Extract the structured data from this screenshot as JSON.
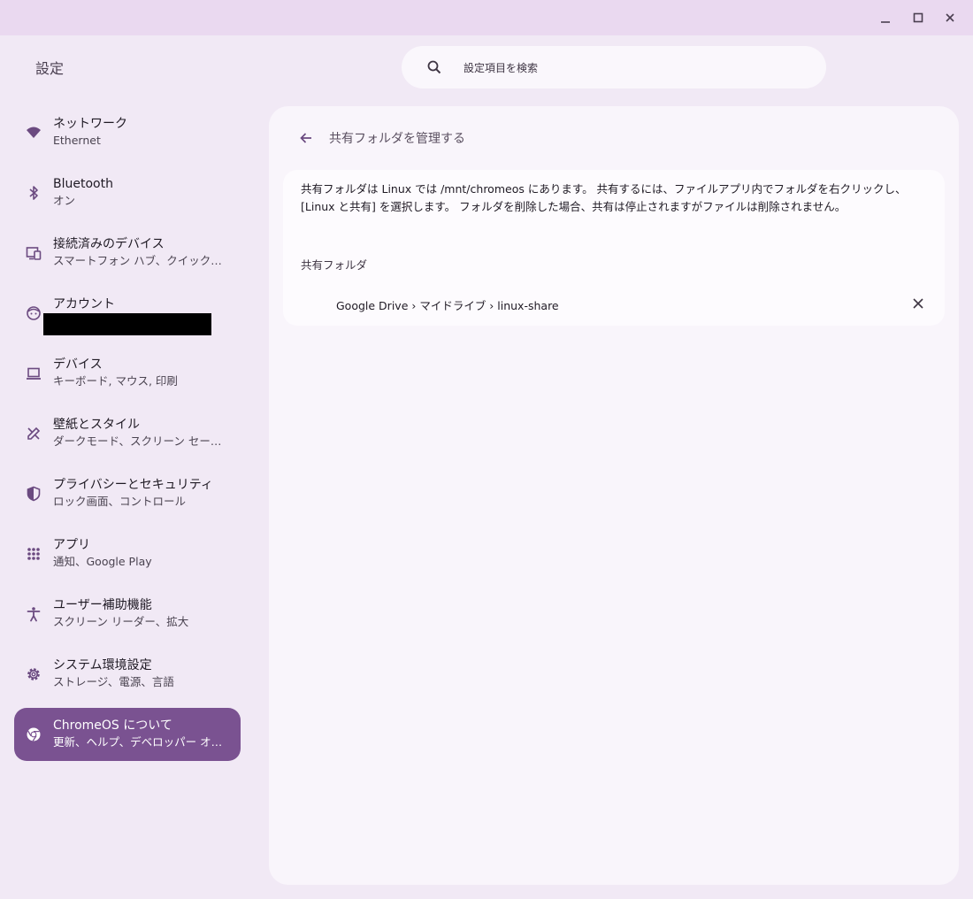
{
  "app": {
    "title": "設定"
  },
  "window_controls": {
    "minimize_icon": "minimize-icon",
    "maximize_icon": "maximize-icon",
    "close_icon": "close-icon"
  },
  "search": {
    "placeholder": "設定項目を検索",
    "icon": "search-icon"
  },
  "sidebar": {
    "items": [
      {
        "label": "ネットワーク",
        "sub": "Ethernet",
        "icon": "wifi-icon"
      },
      {
        "label": "Bluetooth",
        "sub": "オン",
        "icon": "bluetooth-icon"
      },
      {
        "label": "接続済みのデバイス",
        "sub": "スマートフォン ハブ、クイック…",
        "icon": "connected-devices-icon"
      },
      {
        "label": "アカウント",
        "sub": "",
        "icon": "account-icon"
      },
      {
        "label": "デバイス",
        "sub": "キーボード, マウス, 印刷",
        "icon": "laptop-icon"
      },
      {
        "label": "壁紙とスタイル",
        "sub": "ダークモード、スクリーン セー…",
        "icon": "paint-icon"
      },
      {
        "label": "プライバシーとセキュリティ",
        "sub": "ロック画面、コントロール",
        "icon": "shield-icon"
      },
      {
        "label": "アプリ",
        "sub": "通知、Google Play",
        "icon": "apps-grid-icon"
      },
      {
        "label": "ユーザー補助機能",
        "sub": "スクリーン リーダー、拡大",
        "icon": "accessibility-icon"
      },
      {
        "label": "システム環境設定",
        "sub": "ストレージ、電源、言語",
        "icon": "gear-icon"
      },
      {
        "label": "ChromeOS について",
        "sub": "更新、ヘルプ、デベロッパー オ…",
        "icon": "chrome-icon",
        "selected": true
      }
    ]
  },
  "main": {
    "title": "共有フォルダを管理する",
    "description": "共有フォルダは Linux では /mnt/chromeos にあります。 共有するには、ファイルアプリ内でフォルダを右クリックし、[Linux と共有] を選択します。 フォルダを削除した場合、共有は停止されますがファイルは削除されません。",
    "section_title": "共有フォルダ",
    "folders": [
      {
        "path": "Google Drive › マイドライブ › linux-share"
      }
    ]
  },
  "colors": {
    "background": "#f1e9f5",
    "titlebar": "#ead9f0",
    "accent": "#7a5291",
    "icon": "#6b4a80"
  }
}
